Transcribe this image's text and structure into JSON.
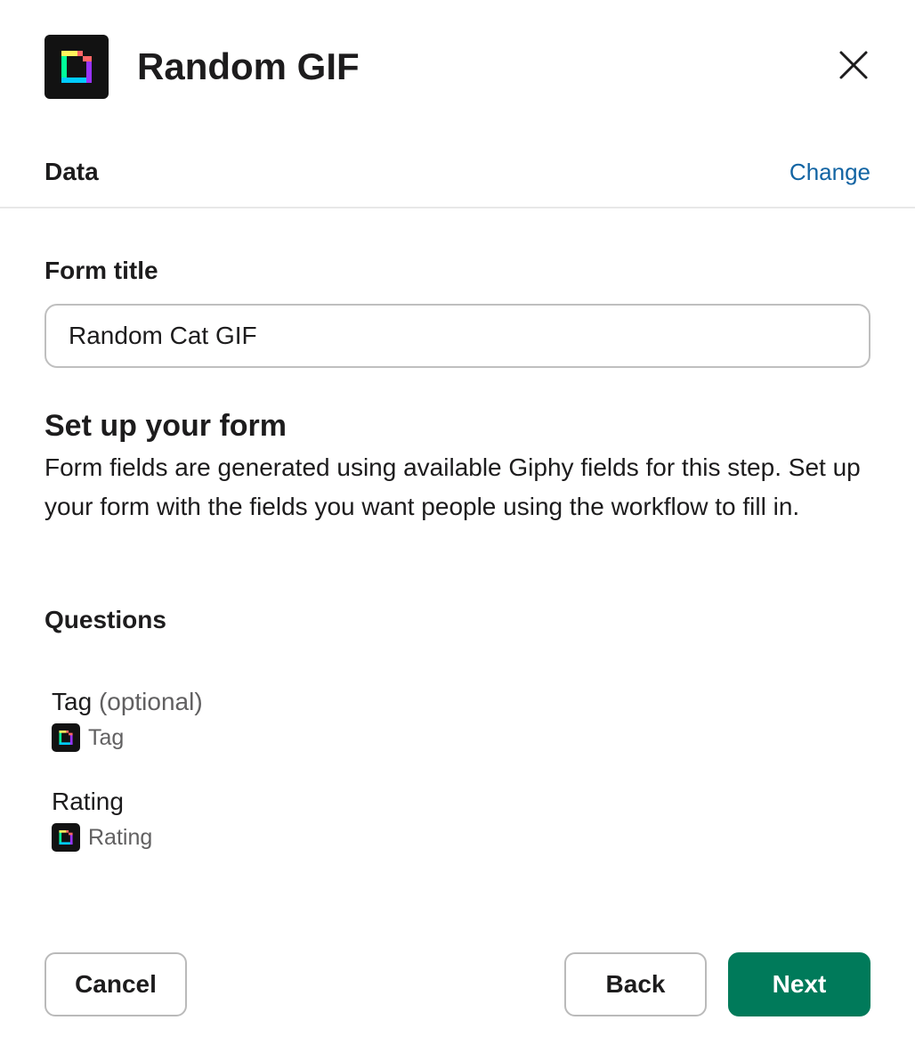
{
  "modal": {
    "title": "Random GIF",
    "app_icon": "giphy-logo-icon",
    "close_icon": "close-icon"
  },
  "data_section": {
    "label": "Data",
    "change_link": "Change"
  },
  "form_title": {
    "label": "Form title",
    "value": "Random Cat GIF",
    "placeholder": ""
  },
  "setup": {
    "title": "Set up your form",
    "description": "Form fields are generated using available Giphy fields for this step. Set up your form with the fields you want people using the workflow to fill in."
  },
  "questions": {
    "heading": "Questions",
    "items": [
      {
        "name": "Tag",
        "optional": "(optional)",
        "source": "Tag",
        "source_icon": "giphy-logo-icon"
      },
      {
        "name": "Rating",
        "optional": "",
        "source": "Rating",
        "source_icon": "giphy-logo-icon"
      }
    ]
  },
  "footer": {
    "cancel_label": "Cancel",
    "back_label": "Back",
    "next_label": "Next"
  },
  "colors": {
    "primary_button": "#007a5a",
    "link": "#1264a3",
    "logo_background": "#121212"
  }
}
